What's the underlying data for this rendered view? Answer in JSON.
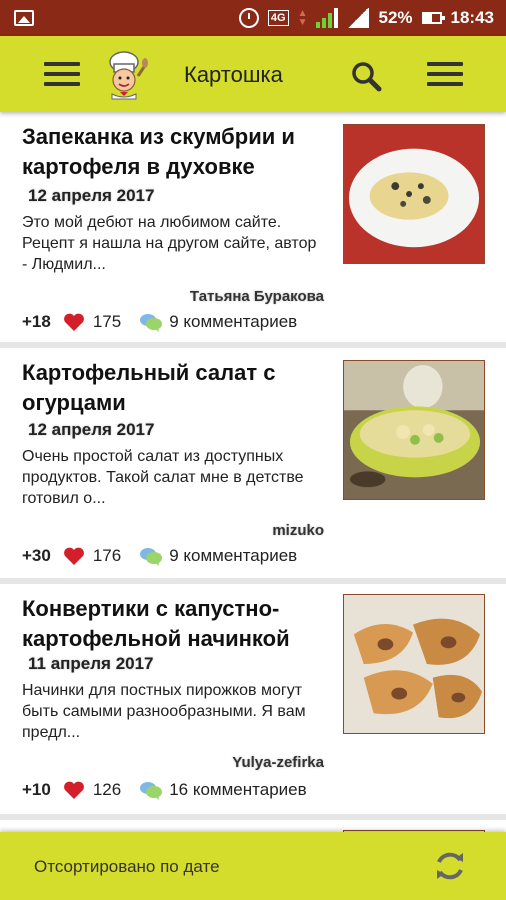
{
  "status_bar": {
    "icons": [
      "image-icon",
      "alarm-icon",
      "network-4g-icon",
      "signal-icon",
      "signal-2-icon",
      "battery-icon"
    ],
    "network": "4G",
    "battery": "52%",
    "time": "18:43"
  },
  "app_bar": {
    "title": "Картошка",
    "left_icon": "menu-icon",
    "logo": "chef-logo-icon",
    "search_icon": "search-icon",
    "right_icon": "menu-icon"
  },
  "recipes": [
    {
      "title": "Запеканка из скумбрии и картофеля в духовке",
      "date": "12 апреля 2017",
      "description": "Это мой дебют на любимом сайте. Рецепт я нашла на другом сайте, автор - Людмил...",
      "author": "Татьяна Буракова",
      "rating": "+18",
      "likes": "175",
      "comments": "9 комментариев"
    },
    {
      "title": "Картофельный салат с огурцами",
      "date": "12 апреля 2017",
      "description": "Очень простой салат из доступных продуктов. Такой салат мне в детстве готовил о...",
      "author": "mizuko",
      "rating": "+30",
      "likes": "176",
      "comments": "9 комментариев"
    },
    {
      "title": "Конвертики с капустно-картофельной начинкой",
      "date": "11 апреля 2017",
      "description": "Начинки для постных пирожков могут быть самыми разнообразными. Я вам предл...",
      "author": "Yulya-zefirka",
      "rating": "+10",
      "likes": "126",
      "comments": "16 комментариев"
    }
  ],
  "bottom_bar": {
    "sort_label": "Отсортировано по дате",
    "refresh_icon": "refresh-icon"
  },
  "colors": {
    "status_bar": "#8a2a16",
    "app_bar": "#d4dc2c",
    "heart": "#d21f2a",
    "divider": "#e6e6e6"
  }
}
